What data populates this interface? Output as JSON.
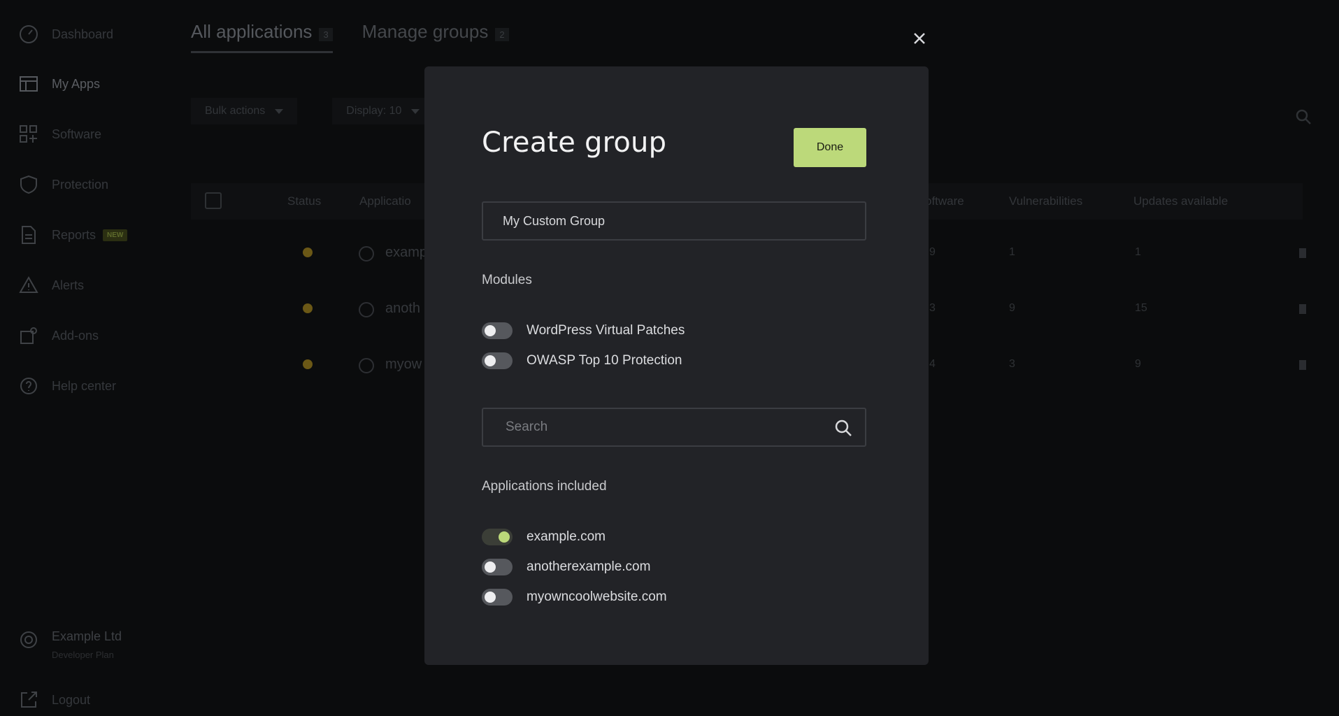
{
  "sidebar": {
    "items": [
      {
        "label": "Dashboard",
        "icon": "dashboard-gauge-icon"
      },
      {
        "label": "My Apps",
        "icon": "apps-layout-icon"
      },
      {
        "label": "Software",
        "icon": "software-grid-icon"
      },
      {
        "label": "Protection",
        "icon": "shield-icon"
      },
      {
        "label": "Reports",
        "icon": "report-file-icon",
        "badge": "NEW"
      },
      {
        "label": "Alerts",
        "icon": "warning-triangle-icon"
      },
      {
        "label": "Add-ons",
        "icon": "add-ons-icon"
      },
      {
        "label": "Help center",
        "icon": "help-circle-icon"
      }
    ],
    "org": {
      "name": "Example Ltd",
      "plan": "Developer Plan",
      "icon": "gear-icon"
    },
    "logout": {
      "label": "Logout",
      "icon": "logout-icon"
    }
  },
  "main": {
    "tabs": [
      {
        "label": "All applications",
        "count": "3"
      },
      {
        "label": "Manage groups",
        "count": "2"
      }
    ],
    "toolbar": {
      "bulk_actions": "Bulk actions",
      "display": "Display: 10"
    },
    "table": {
      "headers": {
        "status": "Status",
        "application": "Applicatio",
        "software": "oftware",
        "vulnerabilities": "Vulnerabilities",
        "updates": "Updates available"
      },
      "rows": [
        {
          "name": "examp",
          "software": "9",
          "vulnerabilities": "1",
          "updates": "1"
        },
        {
          "name": "anoth",
          "software": "3",
          "vulnerabilities": "9",
          "updates": "15"
        },
        {
          "name": "myow",
          "software": "4",
          "vulnerabilities": "3",
          "updates": "9"
        }
      ]
    }
  },
  "modal": {
    "title": "Create group",
    "done_label": "Done",
    "group_name_value": "My Custom Group",
    "modules_label": "Modules",
    "modules": [
      {
        "label": "WordPress Virtual Patches",
        "enabled": false
      },
      {
        "label": "OWASP Top 10 Protection",
        "enabled": false
      }
    ],
    "search_placeholder": "Search",
    "apps_label": "Applications included",
    "applications": [
      {
        "label": "example.com",
        "enabled": true
      },
      {
        "label": "anotherexample.com",
        "enabled": false
      },
      {
        "label": "myowncoolwebsite.com",
        "enabled": false
      }
    ]
  },
  "colors": {
    "accent": "#bcd97a",
    "modal_bg": "#222327",
    "page_bg": "#0b0c0d"
  }
}
